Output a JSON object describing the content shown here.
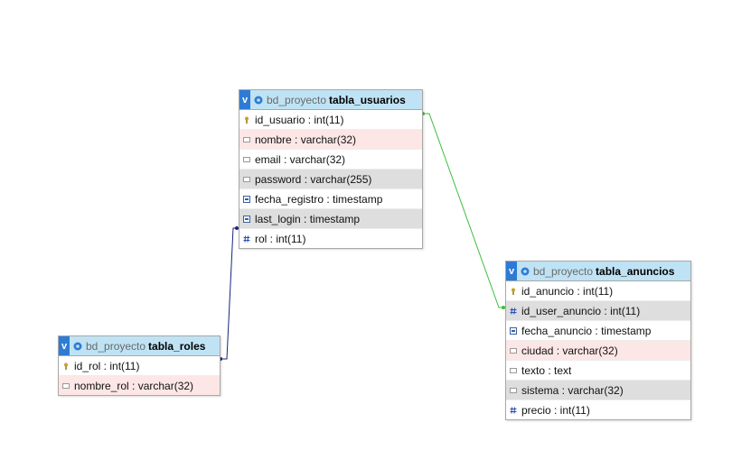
{
  "colors": {
    "header_bg": "#bfe3f4",
    "toggle_bg": "#2e7bd6",
    "row_pink": "#fde6e6",
    "row_gray": "#dedede",
    "link_green": "#3bbf3b",
    "link_blue": "#1a237e"
  },
  "tables": {
    "usuarios": {
      "toggle": "v",
      "db": "bd_proyecto",
      "name": "tabla_usuarios",
      "columns": [
        {
          "text": "id_usuario : int(11)",
          "icon": "key-icon"
        },
        {
          "text": "nombre : varchar(32)",
          "icon": "text-field-icon"
        },
        {
          "text": "email : varchar(32)",
          "icon": "text-field-icon"
        },
        {
          "text": "password : varchar(255)",
          "icon": "text-field-icon"
        },
        {
          "text": "fecha_registro : timestamp",
          "icon": "date-icon"
        },
        {
          "text": "last_login : timestamp",
          "icon": "date-icon"
        },
        {
          "text": "rol : int(11)",
          "icon": "hash-icon"
        }
      ]
    },
    "anuncios": {
      "toggle": "v",
      "db": "bd_proyecto",
      "name": "tabla_anuncios",
      "columns": [
        {
          "text": "id_anuncio : int(11)",
          "icon": "key-icon"
        },
        {
          "text": "id_user_anuncio : int(11)",
          "icon": "hash-icon"
        },
        {
          "text": "fecha_anuncio : timestamp",
          "icon": "date-icon"
        },
        {
          "text": "ciudad : varchar(32)",
          "icon": "text-field-icon"
        },
        {
          "text": "texto : text",
          "icon": "text-field-icon"
        },
        {
          "text": "sistema : varchar(32)",
          "icon": "text-field-icon"
        },
        {
          "text": "precio : int(11)",
          "icon": "hash-icon"
        }
      ]
    },
    "roles": {
      "toggle": "v",
      "db": "bd_proyecto",
      "name": "tabla_roles",
      "columns": [
        {
          "text": "id_rol : int(11)",
          "icon": "key-icon"
        },
        {
          "text": "nombre_rol : varchar(32)",
          "icon": "text-field-icon"
        }
      ]
    }
  }
}
